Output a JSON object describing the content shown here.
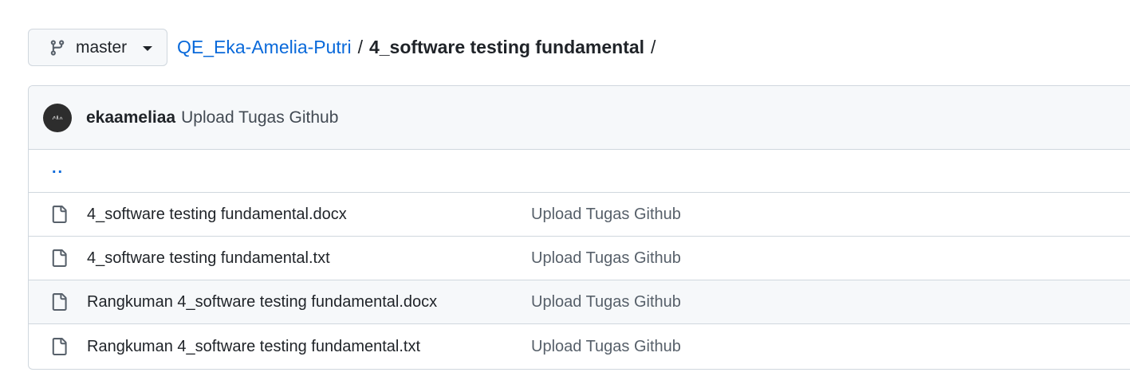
{
  "branch": {
    "label": "master",
    "icon": "git-branch-icon"
  },
  "breadcrumb": {
    "repo": "QE_Eka-Amelia-Putri",
    "separator": "/",
    "folder": "4_software testing fundamental",
    "trailing_separator": "/"
  },
  "latest_commit": {
    "author": "ekaameliaa",
    "message": "Upload Tugas Github"
  },
  "parent_dir": {
    "label": ".."
  },
  "files": [
    {
      "name": "4_software testing fundamental.docx",
      "commit_message": "Upload Tugas Github"
    },
    {
      "name": "4_software testing fundamental.txt",
      "commit_message": "Upload Tugas Github"
    },
    {
      "name": "Rangkuman 4_software testing fundamental.docx",
      "commit_message": "Upload Tugas Github"
    },
    {
      "name": "Rangkuman 4_software testing fundamental.txt",
      "commit_message": "Upload Tugas Github"
    }
  ],
  "colors": {
    "link": "#0969da",
    "border": "#d0d7de",
    "header_bg": "#f6f8fa",
    "muted_text": "#57606a"
  }
}
